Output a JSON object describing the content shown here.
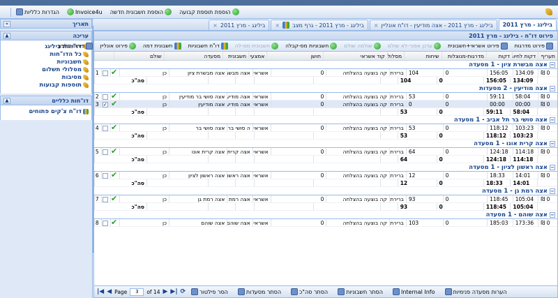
{
  "toolbar": {
    "items": [
      "הגדרות כלליות",
      "Invoice4u",
      "הוספת חשבונית חדשה",
      "הוספת תוספת קבועה"
    ]
  },
  "sidebar": {
    "title_dates": "תאריך",
    "title_edit": "עריכה",
    "edit_items": [
      "דו\"חות ביליגג",
      "כל הדו\"חות",
      "חשבוניות",
      "מסלולי תשלום",
      "מסיבות",
      "תוספות קבועות"
    ],
    "title_general": "דו\"חות כלליים",
    "general_items": [
      "דו\"ח צ'קים פתוחים"
    ]
  },
  "tabs": [
    {
      "label": "ביליגג - מרץ 2011",
      "active": true
    },
    {
      "label": "ביליגג - מרץ 2011 - אצה מודיעין - דו\"ח אונליין",
      "active": false
    },
    {
      "label": "ביליגג - מרץ 2011 - גרף מצב",
      "active": false
    },
    {
      "label": "ביליגג - מרץ 2011",
      "active": false
    }
  ],
  "report": {
    "title": "פירוט דו\"ח - ביליגג - מרץ 2011",
    "toolbar": [
      {
        "label": "פירוט מדרגות",
        "disabled": false
      },
      {
        "label": "פירוט אשראי+חשבונית",
        "disabled": false
      },
      {
        "label": "עדכן אפור-לא שולם",
        "disabled": true
      },
      {
        "label": "שולמה שולם",
        "disabled": true
      },
      {
        "label": "חשבוניות מס-קבלה",
        "disabled": false
      },
      {
        "label": "חשבונית מס-לה",
        "disabled": true
      },
      {
        "label": "דו\"ח חשבוניות",
        "disabled": false
      },
      {
        "label": "חשבונית דמה",
        "disabled": false
      },
      {
        "label": "פירוט אונליין",
        "disabled": false
      },
      {
        "label": "פירוט סלפון",
        "disabled": false
      }
    ],
    "columns": [
      "תעריף",
      "דקות לחיוב",
      "דקות",
      "מדרגות-מנוצלות",
      "שיחות",
      "מסלול תשלום",
      "קוד אשראי",
      "חושן",
      "אמצעי תשלום",
      "חשבונית",
      "מסעדה",
      "שולם",
      ""
    ],
    "groups": [
      {
        "title": "אצה מבשרת ציון - 1 מסעדה",
        "rows": [
          {
            "n": "1",
            "taarif": "0 ₪",
            "dl": "134:09",
            "dk": "156:05",
            "dm": "0",
            "ds": "104",
            "ms": "ברירת מחדל - מדרגות",
            "ka": "קה בוצעה בהצלחה",
            "hs": "0",
            "am": "אשראי",
            "hb": "אצה מבשרת ציון",
            "me": "אצה מבשרת ציון",
            "sh": "כן",
            "checked": false
          }
        ],
        "total": {
          "label": "סה\"כ",
          "dl": "134:09",
          "dk": "156:05",
          "dm": "0",
          "ds": "104"
        }
      },
      {
        "title": "אצה מודיעין - 2 מסעדות",
        "rows": [
          {
            "n": "2",
            "taarif": "0 ₪",
            "dl": "58:04",
            "dk": "59:11",
            "dm": "0",
            "ds": "53",
            "ms": "ברירת מחדל - מדרגות",
            "ka": "קה בוצעה בהצלחה",
            "hs": "0",
            "am": "אשראי",
            "hb": "אצה מודיעין",
            "me": "אצה סושי בר מודיעין",
            "sh": "כן",
            "checked": false
          },
          {
            "n": "3",
            "taarif": "0 ₪",
            "dl": "00:00",
            "dk": "00:00",
            "dm": "0",
            "ds": "0",
            "ms": "ברירת מחדל - מדרגות",
            "ka": "קה בוצעה בהצלחה",
            "hs": "0",
            "am": "אשראי",
            "hb": "אצה מודיעין",
            "me": "אצה מודיעין",
            "sh": "כן",
            "checked": true
          }
        ],
        "total": {
          "label": "סה\"כ",
          "dl": "58:04",
          "dk": "59:11",
          "dm": "0",
          "ds": "53"
        }
      },
      {
        "title": "אצה סושי בר תל אביב - 1 מסעדה",
        "rows": [
          {
            "n": "4",
            "taarif": "0 ₪",
            "dl": "103:23",
            "dk": "118:12",
            "dm": "0",
            "ds": "53",
            "ms": "ברירת מחדל - מדרגות",
            "ka": "קה בוצעה בהצלחה",
            "hs": "0",
            "am": "אשראי",
            "hb": "ה סושי בר תל אביב",
            "me": "אצה סושי בר",
            "sh": "כן",
            "checked": false
          }
        ],
        "total": {
          "label": "סה\"כ",
          "dl": "103:23",
          "dk": "118:12",
          "dm": "0",
          "ds": "53"
        }
      },
      {
        "title": "אצה קרית אונו - 1 מסעדה",
        "rows": [
          {
            "n": "5",
            "taarif": "0 ₪",
            "dl": "114:18",
            "dk": "124:18",
            "dm": "0",
            "ds": "64",
            "ms": "ברירת מחדל - מדרגות",
            "ka": "קה בוצעה בהצלחה",
            "hs": "0",
            "am": "אשראי",
            "hb": "אצה קרית אונו",
            "me": "אצה קרית אונו",
            "sh": "כן",
            "checked": false
          }
        ],
        "total": {
          "label": "סה\"כ",
          "dl": "114:18",
          "dk": "124:18",
          "dm": "0",
          "ds": "64"
        }
      },
      {
        "title": "אצה ראשון לציון - 1 מסעדה",
        "rows": [
          {
            "n": "6",
            "taarif": "0 ₪",
            "dl": "14:01",
            "dk": "18:33",
            "dm": "0",
            "ds": "12",
            "ms": "ברירת מחדל - מדרגות",
            "ka": "קה בוצעה בהצלחה",
            "hs": "0",
            "am": "אשראי",
            "hb": "אצה ראשון לציון",
            "me": "אצה ראשון לציון",
            "sh": "כן",
            "checked": false
          }
        ],
        "total": {
          "label": "סה\"כ",
          "dl": "14:01",
          "dk": "18:33",
          "dm": "0",
          "ds": "12"
        }
      },
      {
        "title": "אצה רמת גן - 1 מסעדה",
        "rows": [
          {
            "n": "7",
            "taarif": "0 ₪",
            "dl": "105:04",
            "dk": "118:45",
            "dm": "0",
            "ds": "93",
            "ms": "ברירת מחדל - מדרגות",
            "ka": "קה בוצעה בהצלחה",
            "hs": "0",
            "am": "אשראי",
            "hb": "אצה רמת גן",
            "me": "אצה רמת גן",
            "sh": "כן",
            "checked": false
          }
        ],
        "total": {
          "label": "סה\"כ",
          "dl": "105:04",
          "dk": "118:45",
          "dm": "0",
          "ds": "93"
        }
      },
      {
        "title": "אצה שוהם - 1 מסעדה",
        "rows": [
          {
            "n": "8",
            "taarif": "0 ₪",
            "dl": "173:36",
            "dk": "185:03",
            "dm": "0",
            "ds": "103",
            "ms": "ברירת מחדל - מדרגות",
            "ka": "קה בוצעה בהצלחה",
            "hs": "0",
            "am": "אשראי",
            "hb": "אצה שוהם",
            "me": "אצה שוהם",
            "sh": "כן",
            "checked": false
          }
        ],
        "total": null
      }
    ]
  },
  "pager": {
    "page_label": "Page",
    "page": "3",
    "of": "of 14",
    "buttons": [
      "הסר פילטור",
      "הסתר מסעדות",
      "הסתר סה\"כ",
      "הסתר חשבוניות",
      "Internal Info",
      "הערות מסעדה פנימיות"
    ]
  }
}
